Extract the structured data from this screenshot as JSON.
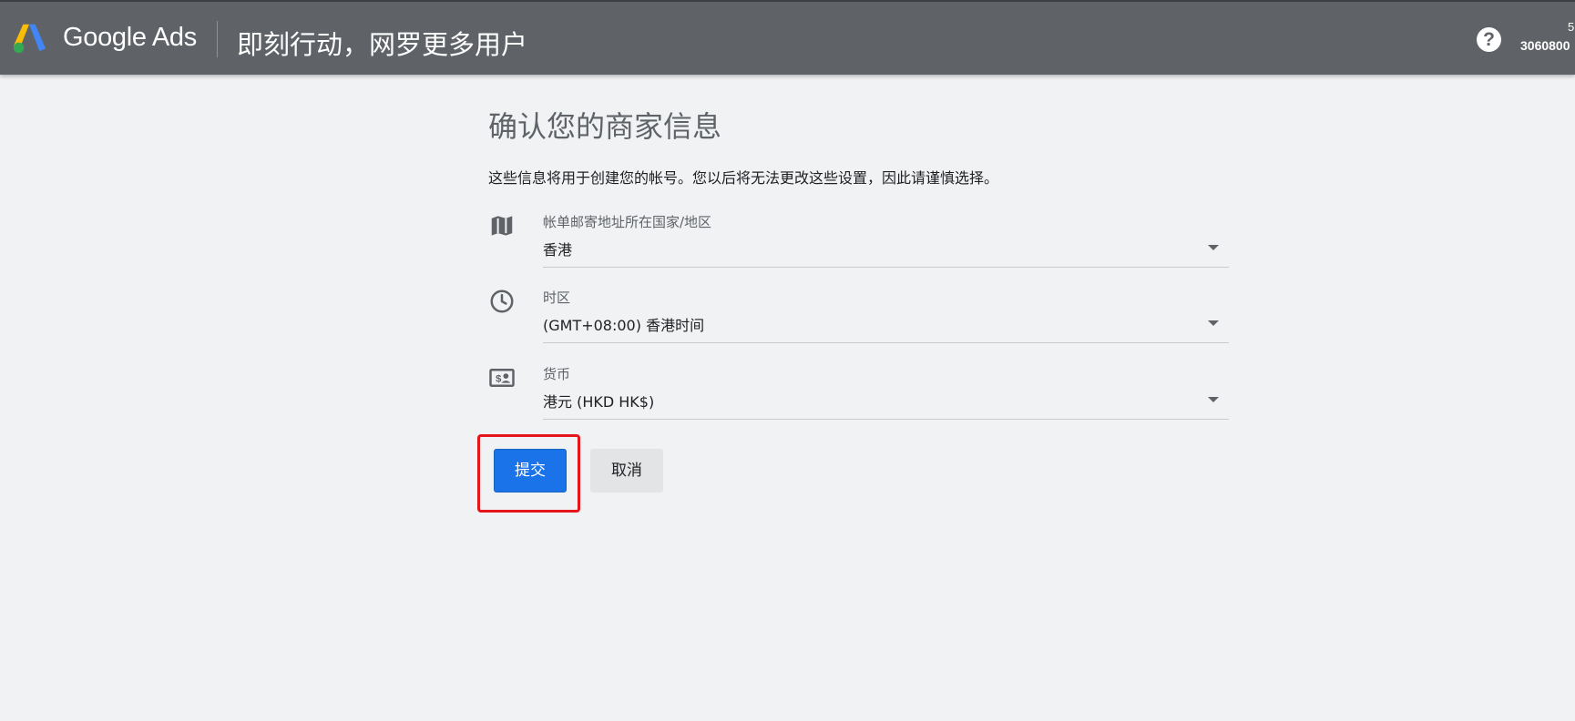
{
  "header": {
    "brand": "Google Ads",
    "slogan": "即刻行动，网罗更多用户",
    "help_icon": "help-circle-icon",
    "help_glyph": "?",
    "account_top": "5",
    "account_id": "3060800"
  },
  "main": {
    "title": "确认您的商家信息",
    "description": "这些信息将用于创建您的帐号。您以后将无法更改这些设置，因此请谨慎选择。",
    "fields": [
      {
        "icon": "map-icon",
        "label": "帐单邮寄地址所在国家/地区",
        "value": "香港"
      },
      {
        "icon": "clock-icon",
        "label": "时区",
        "value": "(GMT+08:00) 香港时间"
      },
      {
        "icon": "currency-icon",
        "label": "货币",
        "value": "港元 (HKD HK$)"
      }
    ],
    "submit_label": "提交",
    "cancel_label": "取消"
  },
  "colors": {
    "topbar": "#5f6368",
    "background": "#f1f2f4",
    "primary": "#1a73e8",
    "highlight": "#e4161b"
  }
}
